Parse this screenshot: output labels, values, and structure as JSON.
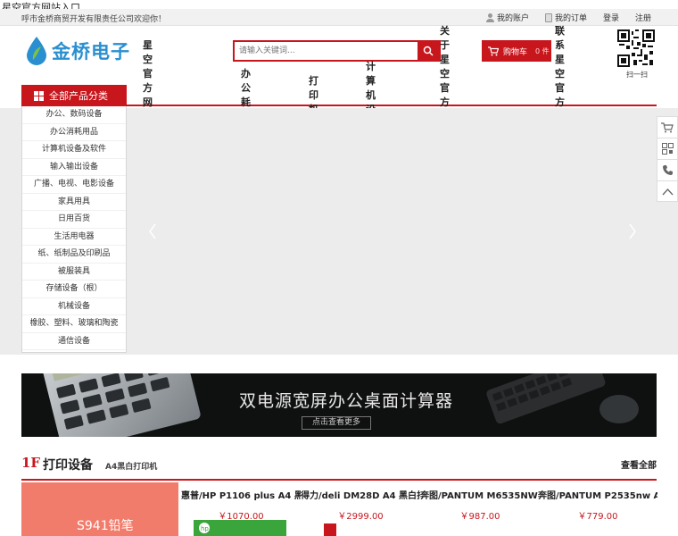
{
  "page_title": "星空官方网站入口",
  "topbar": {
    "welcome": "呼市金桥商贸开发有限责任公司欢迎你！",
    "account": "我的账户",
    "orders": "我的订单",
    "login": "登录",
    "register": "注册"
  },
  "header": {
    "logo_text": "金桥电子",
    "search_placeholder": "请输入关键词...",
    "cart_label": "购物车",
    "cart_count": "0 件",
    "qr_caption": "扫一扫"
  },
  "nav": {
    "all_categories": "全部产品分类",
    "items": [
      "星空官方网站入口",
      "办公耗材",
      "打印机",
      "计算机设备",
      "关于星空官方网站入口",
      "联系星空官方网站入口"
    ]
  },
  "categories": [
    "办公、数码设备",
    "办公消耗用品",
    "计算机设备及软件",
    "输入输出设备",
    "广播、电视、电影设备",
    "家具用具",
    "日用百货",
    "生活用电器",
    "纸、纸制品及印刷品",
    "被服装具",
    "存储设备（根）",
    "机械设备",
    "橡胶、塑料、玻璃和陶瓷",
    "通信设备"
  ],
  "promo": {
    "title": "双电源宽屏办公桌面计算器",
    "more": "点击查看更多"
  },
  "floor": {
    "num": "1F",
    "title": "打印设备",
    "subtitle": "A4黑白打印机",
    "view_all": "查看全部",
    "ad_text": "S941铅笔",
    "products": [
      {
        "name": "惠普/HP P1106 plus A4 黑白...",
        "price": "￥1070.00"
      },
      {
        "name": "得力/deli DM28D A4 黑白打印...",
        "price": "￥2999.00"
      },
      {
        "name": "奔图/PANTUM M6535NW A4 ...",
        "price": "￥987.00"
      },
      {
        "name": "奔图/PANTUM P2535nw A4 ...",
        "price": "￥779.00"
      }
    ]
  },
  "colors": {
    "brand_red": "#c8161d",
    "logo_blue": "#2a8fd0"
  }
}
